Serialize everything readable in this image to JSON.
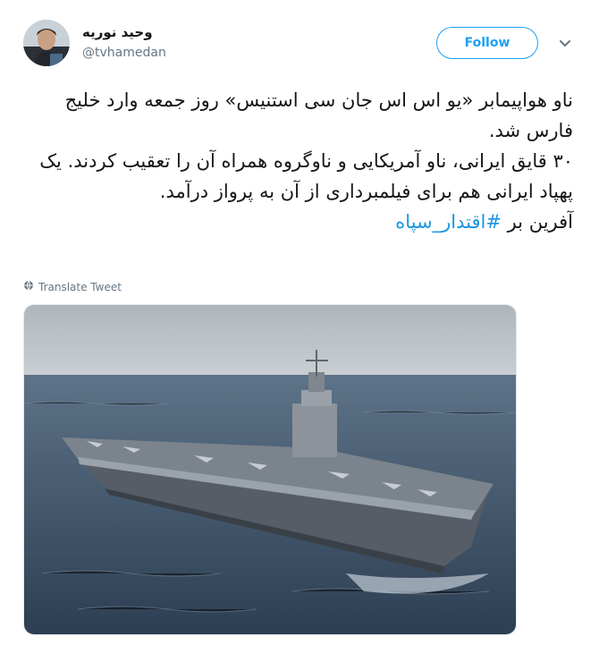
{
  "author": {
    "display_name": "وحید نوریه",
    "handle": "@tvhamedan"
  },
  "actions": {
    "follow_label": "Follow"
  },
  "tweet": {
    "para1": "ناو هواپیمابر «یو اس اس جان سی استنیس» روز جمعه وارد خلیج فارس شد.",
    "para2": "۳۰ قایق ایرانی، ناو آمریکایی و ناوگروه همراه آن را تعقیب کردند. یک پهپاد ایرانی هم برای فیلمبرداری از آن به پرواز درآمد.",
    "para3_prefix": "آفرین بر ",
    "hashtag": "#اقتدار_سپاه"
  },
  "translate_label": "Translate Tweet",
  "colors": {
    "accent": "#1da1f2",
    "hashtag": "#1b95e0",
    "secondary_text": "#657786"
  }
}
